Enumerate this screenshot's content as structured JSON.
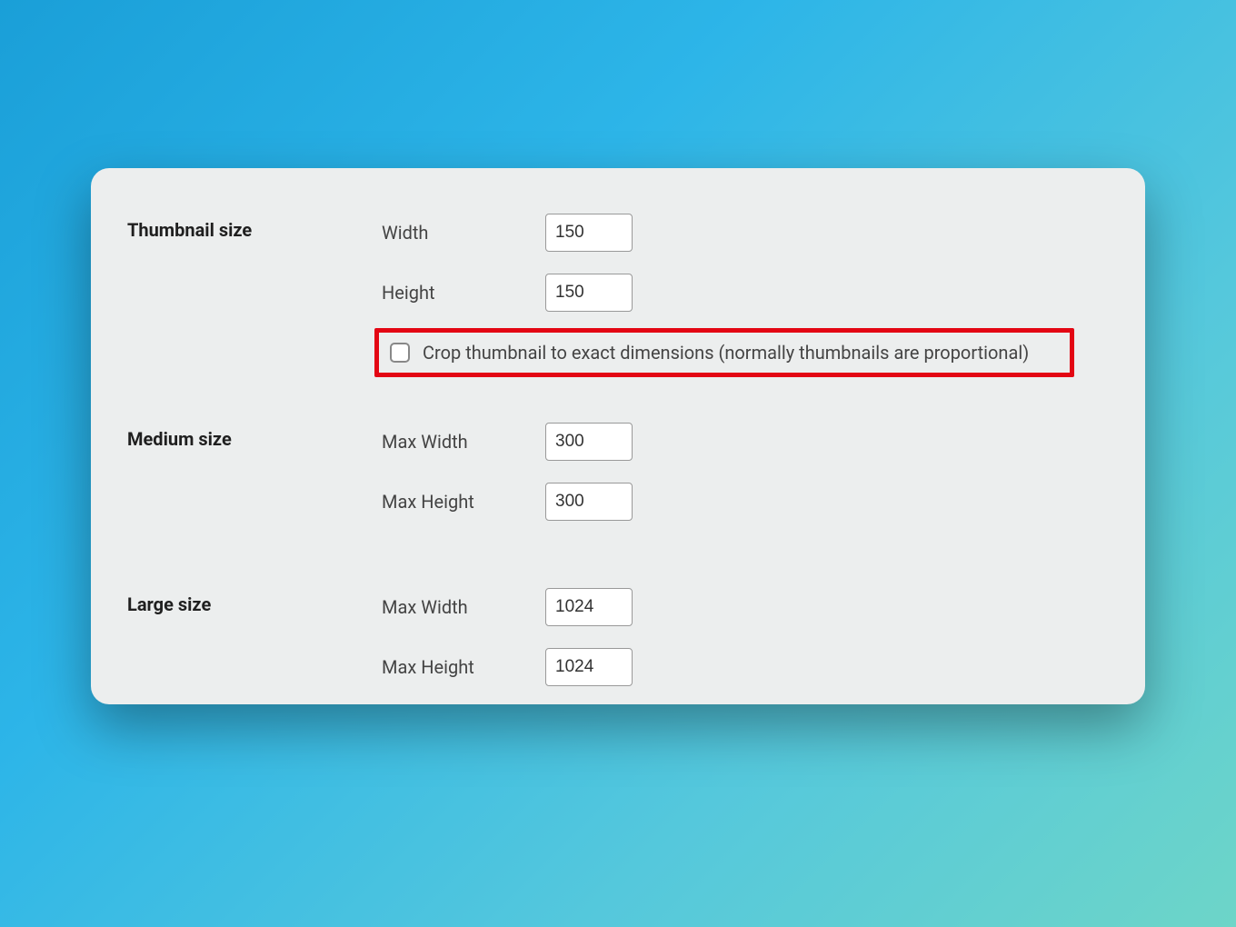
{
  "sections": {
    "thumbnail": {
      "title": "Thumbnail size",
      "width_label": "Width",
      "width_value": "150",
      "height_label": "Height",
      "height_value": "150",
      "crop_label": "Crop thumbnail to exact dimensions (normally thumbnails are proportional)"
    },
    "medium": {
      "title": "Medium size",
      "width_label": "Max Width",
      "width_value": "300",
      "height_label": "Max Height",
      "height_value": "300"
    },
    "large": {
      "title": "Large size",
      "width_label": "Max Width",
      "width_value": "1024",
      "height_label": "Max Height",
      "height_value": "1024"
    }
  }
}
